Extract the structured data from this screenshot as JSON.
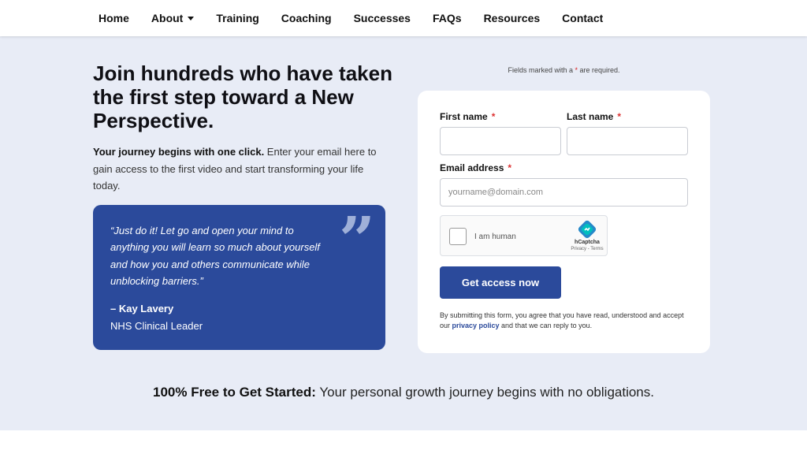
{
  "nav": {
    "items": [
      {
        "label": "Home"
      },
      {
        "label": "About",
        "dropdown": true
      },
      {
        "label": "Training"
      },
      {
        "label": "Coaching"
      },
      {
        "label": "Successes"
      },
      {
        "label": "FAQs"
      },
      {
        "label": "Resources"
      },
      {
        "label": "Contact"
      }
    ]
  },
  "hero": {
    "headline": "Join hundreds who have taken the first step toward a New Perspective.",
    "intro_bold": "Your journey begins with one click.",
    "intro_rest": " Enter your email here to gain access to the first video and start transforming your life today."
  },
  "quote": {
    "text": "“Just do it! Let go and open your mind to anything you will learn so much about yourself and how you and others communicate while unblocking barriers.”",
    "author": "– Kay Lavery",
    "role": "NHS Clinical Leader",
    "mark": "”"
  },
  "form": {
    "required_note_pre": "Fields marked with a ",
    "required_note_star": "*",
    "required_note_post": " are required.",
    "first_name_label": "First name",
    "last_name_label": "Last name",
    "email_label": "Email address",
    "required_star": "*",
    "email_placeholder": "yourname@domain.com",
    "first_name_value": "",
    "last_name_value": "",
    "email_value": "",
    "captcha": {
      "label": "I am human",
      "brand": "hCaptcha",
      "links": "Privacy - Terms"
    },
    "submit_label": "Get access now",
    "disclaimer_pre": "By submitting this form, you agree that you have read, understood and accept our ",
    "disclaimer_link": "privacy policy",
    "disclaimer_post": " and that we can reply to you."
  },
  "bottom": {
    "bold": "100% Free to Get Started:",
    "rest": " Your personal growth journey begins with no obligations."
  },
  "colors": {
    "accent": "#2b4a9b",
    "background": "#e8ecf6",
    "required": "#d33333"
  }
}
